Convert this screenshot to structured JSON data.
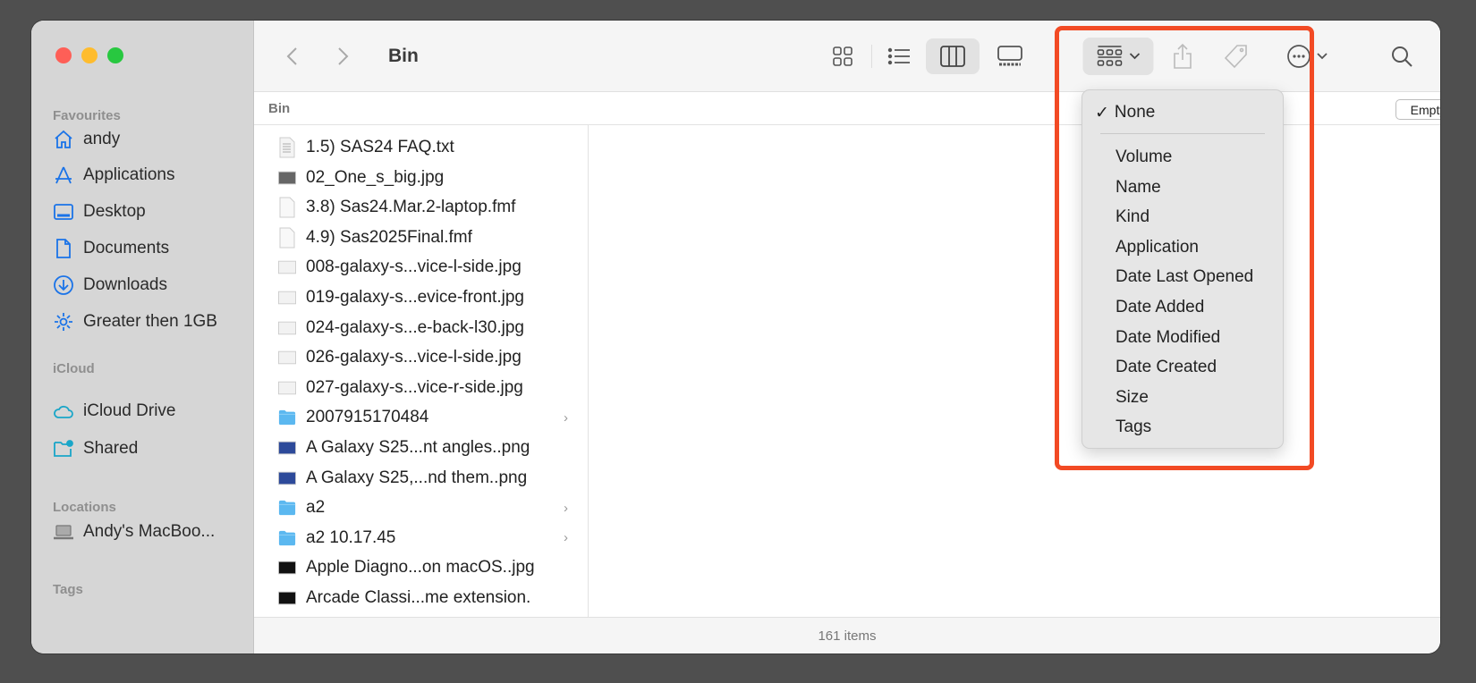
{
  "window": {
    "title": "Bin",
    "path": "Bin",
    "empty_button": "Empty",
    "status": "161 items"
  },
  "sidebar": {
    "sections": [
      {
        "title": "Favourites",
        "items": [
          "andy",
          "Applications",
          "Desktop",
          "Documents",
          "Downloads",
          "Greater then 1GB"
        ]
      },
      {
        "title": "iCloud",
        "items": [
          "iCloud Drive",
          "Shared"
        ]
      },
      {
        "title": "Locations",
        "items": [
          "Andy's MacBoo..."
        ]
      },
      {
        "title": "Tags",
        "items": []
      }
    ]
  },
  "files": [
    {
      "name": "1.5) SAS24 FAQ.txt",
      "type": "text"
    },
    {
      "name": "02_One_s_big.jpg",
      "type": "image"
    },
    {
      "name": "3.8) Sas24.Mar.2-laptop.fmf",
      "type": "doc"
    },
    {
      "name": "4.9) Sas2025Final.fmf",
      "type": "doc"
    },
    {
      "name": "008-galaxy-s...vice-l-side.jpg",
      "type": "image-light"
    },
    {
      "name": "019-galaxy-s...evice-front.jpg",
      "type": "image-light"
    },
    {
      "name": "024-galaxy-s...e-back-l30.jpg",
      "type": "image-light"
    },
    {
      "name": "026-galaxy-s...vice-l-side.jpg",
      "type": "image-light"
    },
    {
      "name": "027-galaxy-s...vice-r-side.jpg",
      "type": "image-light"
    },
    {
      "name": "2007915170484",
      "type": "folder"
    },
    {
      "name": "A Galaxy S25...nt angles..png",
      "type": "image-blue"
    },
    {
      "name": "A Galaxy S25,...nd them..png",
      "type": "image-blue"
    },
    {
      "name": "a2",
      "type": "folder"
    },
    {
      "name": "a2 10.17.45",
      "type": "folder"
    },
    {
      "name": "Apple Diagno...on macOS..jpg",
      "type": "image-dark"
    },
    {
      "name": "Arcade Classi...me extension.",
      "type": "image-dark"
    }
  ],
  "group_menu": {
    "selected": "None",
    "check": "✓",
    "items": [
      "Volume",
      "Name",
      "Kind",
      "Application",
      "Date Last Opened",
      "Date Added",
      "Date Modified",
      "Date Created",
      "Size",
      "Tags"
    ]
  },
  "colors": {
    "accent": "#1a73e8",
    "highlight": "#f24a24",
    "folder": "#5bb8f0"
  }
}
